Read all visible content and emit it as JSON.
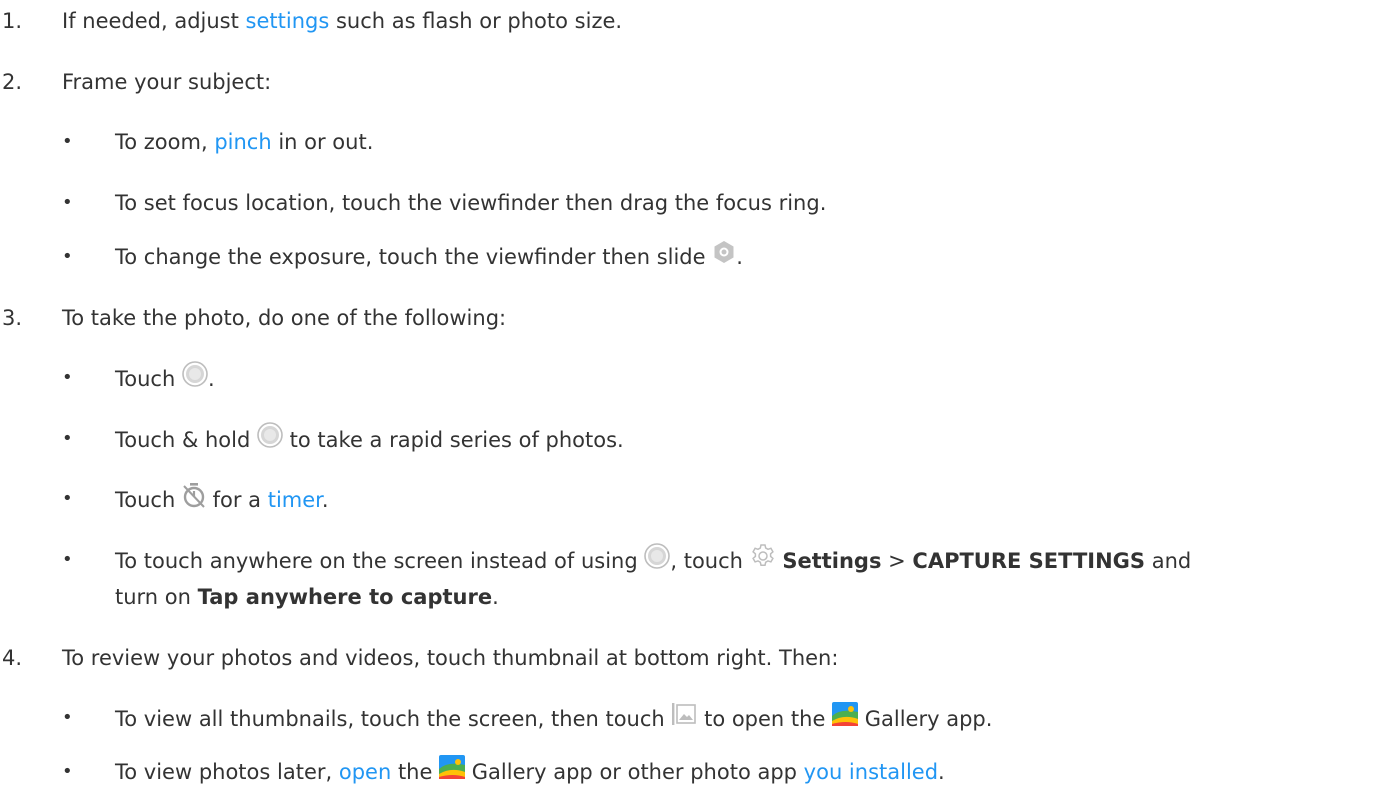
{
  "steps": {
    "s1": {
      "num": "1.",
      "pre": "If needed, adjust ",
      "link": "settings",
      "post": " such as flash or photo size."
    },
    "s2": {
      "num": "2.",
      "text": "Frame your subject:",
      "b1": {
        "pre": "To zoom, ",
        "link": "pinch",
        "post": " in or out."
      },
      "b2": {
        "text": "To set focus location, touch the viewfinder then drag the focus ring."
      },
      "b3": {
        "pre": "To change the exposure, touch the viewfinder then slide ",
        "post": "."
      }
    },
    "s3": {
      "num": "3.",
      "text": "To take the photo, do one of the following:",
      "b1": {
        "pre": "Touch ",
        "post": "."
      },
      "b2": {
        "pre": "Touch & hold ",
        "post": " to take a rapid series of photos."
      },
      "b3": {
        "pre": "Touch ",
        "mid": " for a ",
        "link": "timer",
        "post": "."
      },
      "b4": {
        "pre": "To touch anywhere on the screen instead of using ",
        "mid1": ", touch ",
        "settings": "Settings",
        "sep": " > ",
        "capture": "CAPTURE SETTINGS",
        "mid2": " and",
        "line2pre": "turn on ",
        "tap": "Tap anywhere to capture",
        "post": "."
      }
    },
    "s4": {
      "num": "4.",
      "text": "To review your photos and videos, touch thumbnail at bottom right. Then:",
      "b1": {
        "pre": "To view all thumbnails, touch the screen, then touch ",
        "mid": " to open the ",
        "post": " Gallery app."
      },
      "b2": {
        "pre": "To view photos later, ",
        "link1": "open",
        "mid": " the ",
        "post": " Gallery app or other photo app ",
        "link2": "you installed",
        "end": "."
      }
    }
  },
  "bullet_char": "•",
  "icons": [
    "exposure-icon",
    "shutter-icon",
    "timer-icon",
    "settings-gear-icon",
    "gallery-thumbnail-icon",
    "gallery-app-icon"
  ],
  "colors": {
    "text": "#333333",
    "link": "#2196f3",
    "icon_gray": "#bdbdbd"
  }
}
